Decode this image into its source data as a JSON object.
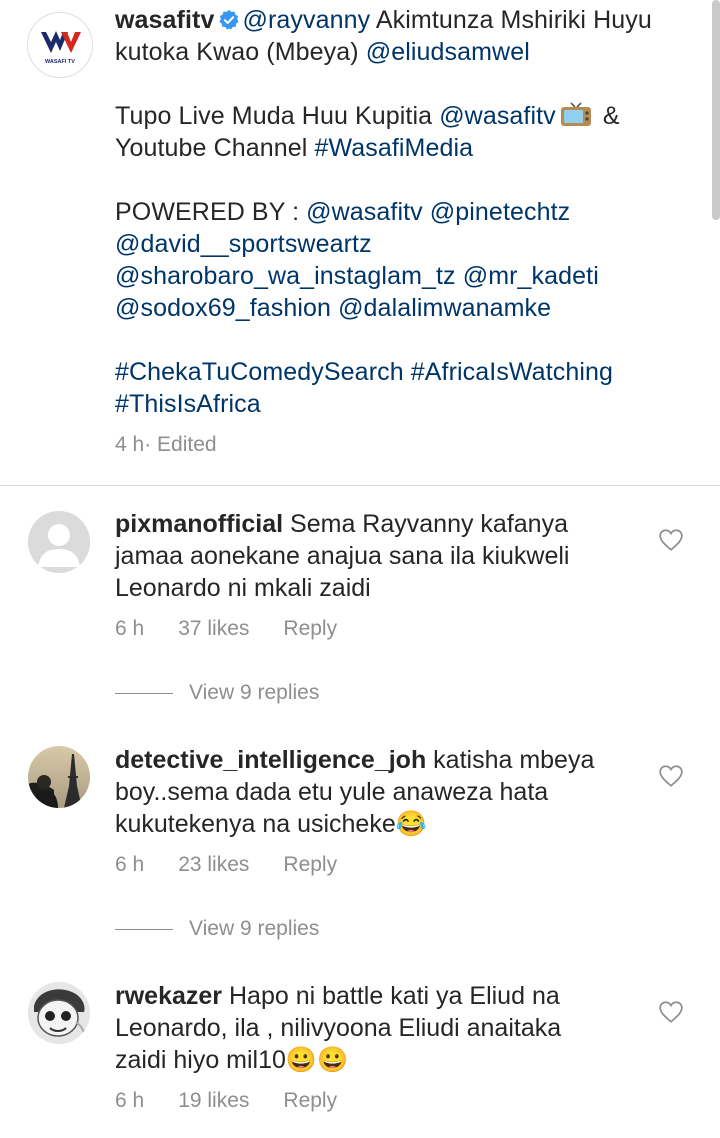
{
  "post": {
    "username": "wasafitv",
    "avatar_text": "WASAFI TV",
    "line1_mention": "@rayvanny",
    "line1_text": " Akimtunza Mshiriki Huyu kutoka Kwao (Mbeya) ",
    "line1_mention2": "@eliudsamwel",
    "line2_text": "Tupo Live Muda Huu Kupitia ",
    "line2_mention": "@wasafitv",
    "line2_after": " & Youtube Channel ",
    "line2_hashtag": "#WasafiMedia",
    "powered_label": "POWERED BY : ",
    "powered_mentions": [
      "@wasafitv",
      "@pinetechtz",
      "@david__sportsweartz",
      "@sharobaro_wa_instaglam_tz",
      "@mr_kadeti",
      "@sodox69_fashion",
      "@dalalimwanamke"
    ],
    "hashtags": [
      "#ChekaTuComedySearch",
      "#AfricaIsWatching",
      "#ThisIsAfrica"
    ],
    "time": "4 h",
    "edited": " · Edited"
  },
  "comments": [
    {
      "username": "pixmanofficial",
      "text": "Sema Rayvanny kafanya jamaa aonekane anajua sana ila kiukweli Leonardo ni mkali zaidi",
      "time": "6 h",
      "likes": "37 likes",
      "reply": "Reply",
      "view_replies": "View 9 replies"
    },
    {
      "username": "detective_intelligence_joh",
      "text": "katisha mbeya boy..sema dada etu yule anaweza hata kukutekenya na usicheke😂",
      "time": "6 h",
      "likes": "23 likes",
      "reply": "Reply",
      "view_replies": "View 9 replies"
    },
    {
      "username": "rwekazer",
      "text": "Hapo ni battle kati ya Eliud na Leonardo, ila , nilivyoona Eliudi anaitaka zaidi hiyo mil10😀😀",
      "time": "6 h",
      "likes": "19 likes",
      "reply": "Reply"
    }
  ],
  "colors": {
    "link": "#003569",
    "muted": "#8e8e8e",
    "text": "#262626",
    "verified": "#3897f0"
  }
}
